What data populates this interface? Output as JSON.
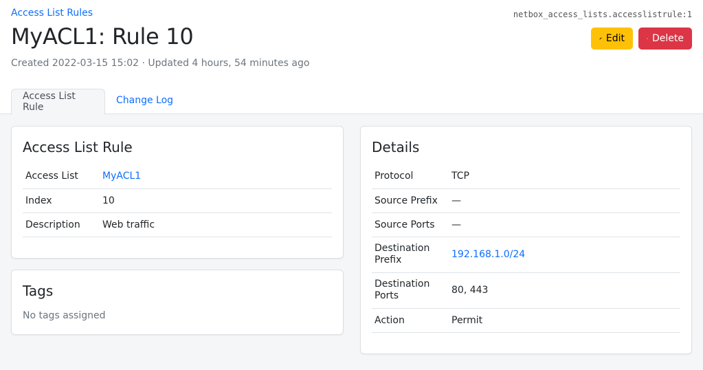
{
  "breadcrumb": {
    "label": "Access List Rules"
  },
  "object_id": "netbox_access_lists.accesslistrule:1",
  "title": "MyACL1: Rule 10",
  "meta": "Created 2022-03-15 15:02 · Updated 4 hours, 54 minutes ago",
  "buttons": {
    "edit": "Edit",
    "delete": "Delete",
    "edit_icon": "pencil-icon",
    "delete_icon": "trash-icon"
  },
  "tabs": [
    {
      "label": "Access List Rule",
      "active": true
    },
    {
      "label": "Change Log",
      "active": false
    }
  ],
  "rule_card": {
    "title": "Access List Rule",
    "rows": [
      {
        "label": "Access List",
        "value": "MyACL1",
        "link": true
      },
      {
        "label": "Index",
        "value": "10",
        "link": false
      },
      {
        "label": "Description",
        "value": "Web traffic",
        "link": false
      }
    ]
  },
  "tags_card": {
    "title": "Tags",
    "empty": "No tags assigned"
  },
  "details_card": {
    "title": "Details",
    "rows": [
      {
        "label": "Protocol",
        "value": "TCP",
        "link": false
      },
      {
        "label": "Source Prefix",
        "value": "—",
        "link": false
      },
      {
        "label": "Source Ports",
        "value": "—",
        "link": false
      },
      {
        "label": "Destination Prefix",
        "value": "192.168.1.0/24",
        "link": true
      },
      {
        "label": "Destination Ports",
        "value": "80, 443",
        "link": false
      },
      {
        "label": "Action",
        "value": "Permit",
        "link": false
      }
    ]
  },
  "colors": {
    "link": "#0d6efd",
    "edit": "#ffc107",
    "delete": "#dc3545"
  }
}
